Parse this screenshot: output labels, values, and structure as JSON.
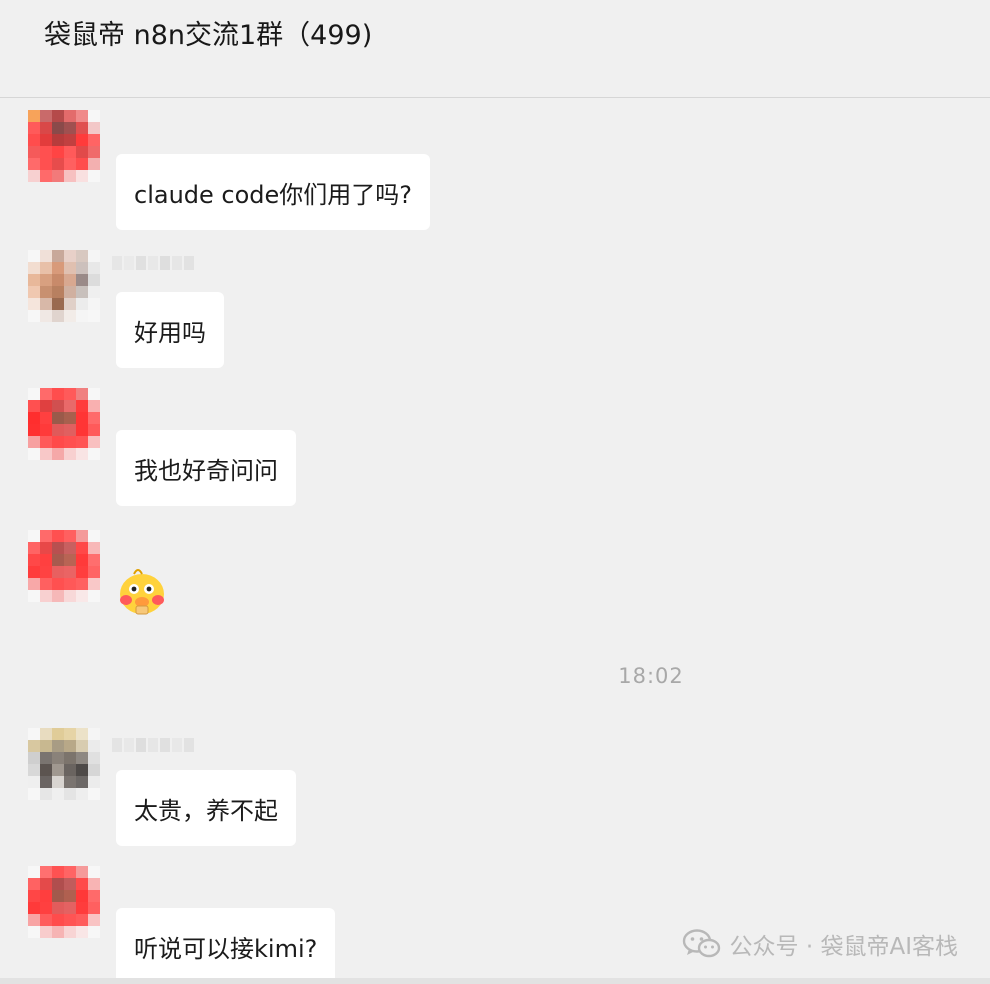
{
  "header": {
    "title": "袋鼠帝 n8n交流1群（499)"
  },
  "messages": [
    {
      "text": "claude code你们用了吗?"
    },
    {
      "text": "好用吗"
    },
    {
      "text": "我也好奇问问"
    },
    {
      "sticker": "duck-sticker"
    },
    {
      "text": "太贵，养不起"
    },
    {
      "text": "听说可以接kimi?"
    }
  ],
  "timestamp": "18:02",
  "watermark": {
    "icon": "wechat-icon",
    "text": "公众号 · 袋鼠帝AI客栈"
  },
  "colors": {
    "background": "#f0f0f0",
    "bubble": "#ffffff",
    "timestamp": "#a8a8a8",
    "watermark": "#b8b8b8"
  }
}
